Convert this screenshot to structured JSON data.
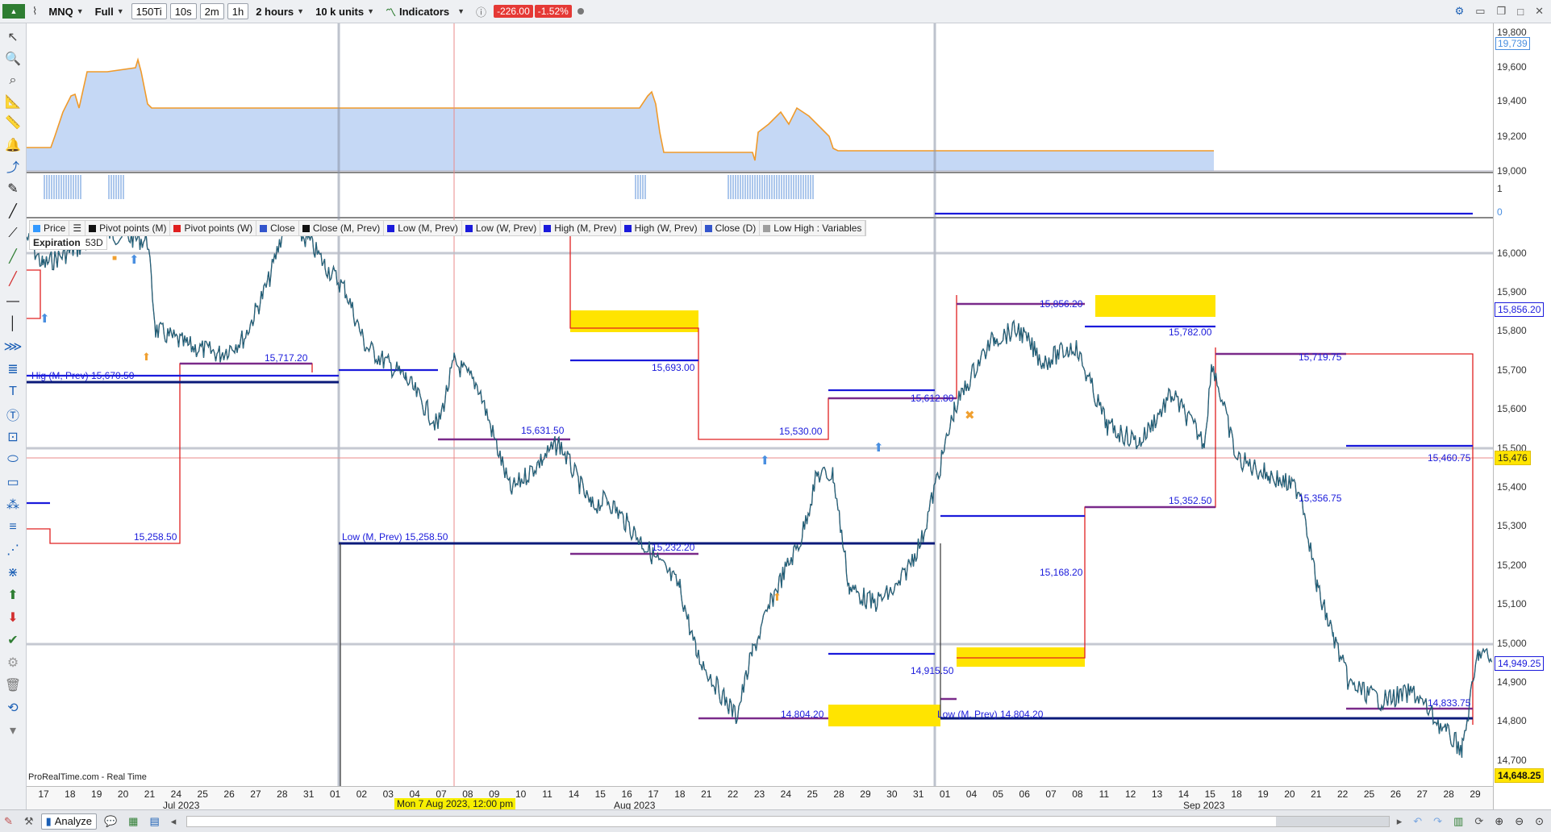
{
  "toolbar": {
    "instrument": "MNQ",
    "mode": "Full",
    "intervals": [
      "150Ti",
      "10s",
      "2m",
      "1h"
    ],
    "range": "2 hours",
    "units": "10 k units",
    "indicators": "Indicators",
    "change": "-226.00",
    "change_pct": "-1.52%"
  },
  "legend": {
    "items": [
      {
        "label": "Price",
        "color": "#3399ff"
      },
      {
        "label": "Pivot points (M)",
        "color": "#111111"
      },
      {
        "label": "Pivot points (W)",
        "color": "#e02020"
      },
      {
        "label": "Close",
        "color": "#3355cc"
      },
      {
        "label": "Close (M, Prev)",
        "color": "#111111"
      },
      {
        "label": "Low (M, Prev)",
        "color": "#1a1adb"
      },
      {
        "label": "Low (W, Prev)",
        "color": "#1a1adb"
      },
      {
        "label": "High (M, Prev)",
        "color": "#1a1adb"
      },
      {
        "label": "High (W, Prev)",
        "color": "#1a1adb"
      },
      {
        "label": "Close (D)",
        "color": "#3355cc"
      },
      {
        "label": "Low High : Variables",
        "color": "#9e9e9e"
      }
    ],
    "expiration_label": "Expiration",
    "expiration_value": "53D"
  },
  "upper_axis": [
    "19,800",
    "19,739",
    "19,600",
    "19,400",
    "19,200",
    "19,000",
    "1",
    "0"
  ],
  "price_axis": [
    "16,000",
    "15,900",
    "15,800",
    "15,700",
    "15,600",
    "15,500",
    "15,400",
    "15,300",
    "15,200",
    "15,100",
    "15,000",
    "14,900",
    "14,800",
    "14,700"
  ],
  "price_boxes": {
    "p1": "15,856.20",
    "p2": "15,476",
    "p3": "14,949.25",
    "p4": "14,648.25"
  },
  "level_labels": [
    "Hig (M, Prev) 15,670.50",
    "15,717.20",
    "15,631.50",
    "15,693.00",
    "15,530.00",
    "15,612.80",
    "15,856.20",
    "15,782.00",
    "15,719.75",
    "15,460.75",
    "15,258.50",
    "Low (M, Prev) 15,258.50",
    "15,232.20",
    "15,352.50",
    "15,356.75",
    "15,168.20",
    "14,915.50",
    "14,804.20",
    "Low (M, Prev) 14,804.20",
    "14,833.75"
  ],
  "watermark": "ProRealTime.com - Real Time",
  "date_axis": {
    "days": [
      "17",
      "18",
      "19",
      "20",
      "21",
      "24",
      "25",
      "26",
      "27",
      "28",
      "31",
      "01",
      "02",
      "03",
      "04",
      "07",
      "08",
      "09",
      "10",
      "11",
      "14",
      "15",
      "16",
      "17",
      "18",
      "21",
      "22",
      "23",
      "24",
      "25",
      "28",
      "29",
      "30",
      "31",
      "01",
      "04",
      "05",
      "06",
      "07",
      "08",
      "11",
      "12",
      "13",
      "14",
      "15",
      "18",
      "19",
      "20",
      "21",
      "22",
      "25",
      "26",
      "27",
      "28",
      "29"
    ],
    "months": [
      "Jul 2023",
      "Aug 2023",
      "Sep 2023"
    ],
    "cursor_date": "Mon 7 Aug 2023, 12:00 pm"
  },
  "bottombar": {
    "analyze": "Analyze"
  }
}
